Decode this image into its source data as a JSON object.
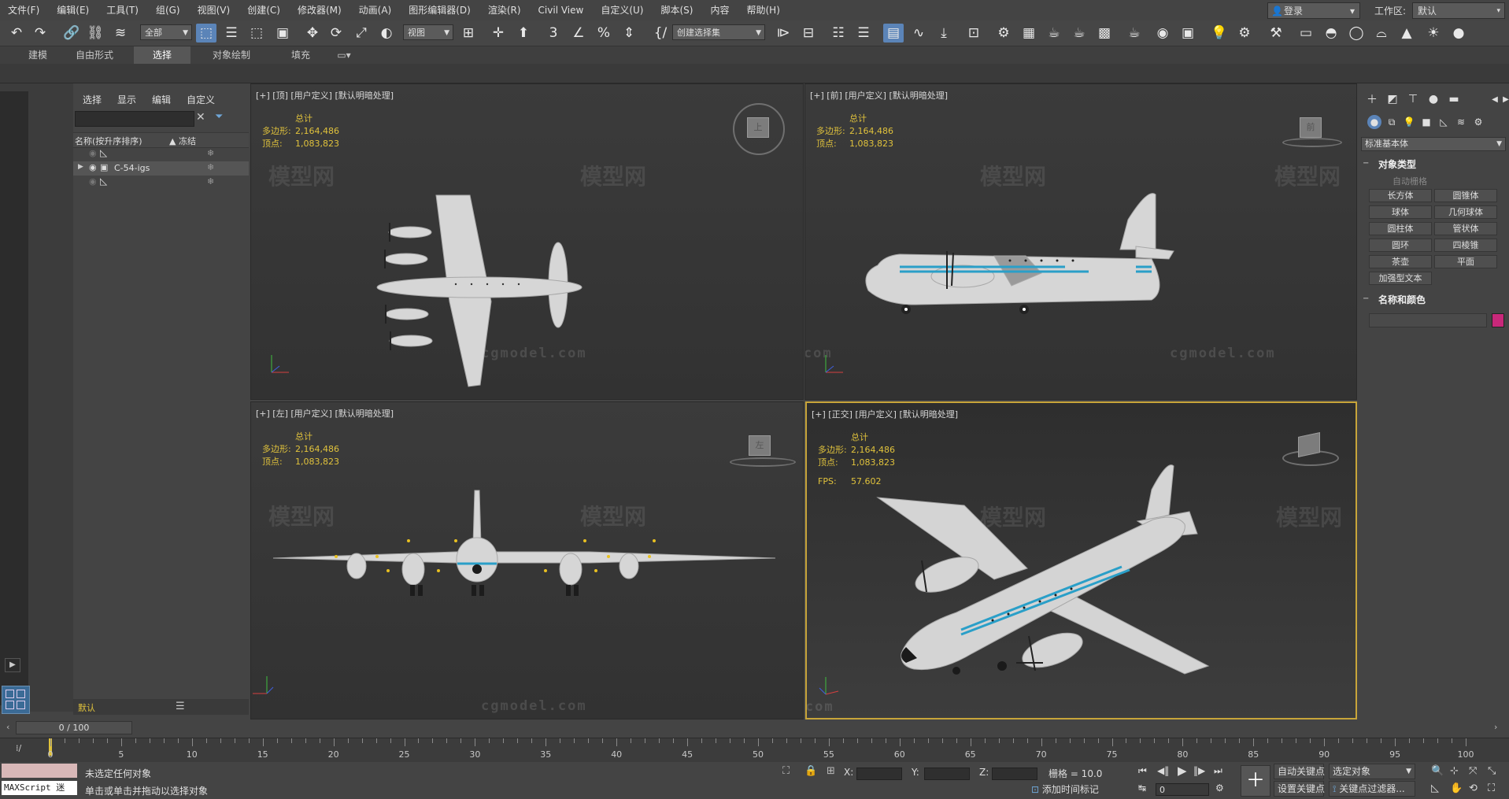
{
  "menu": [
    "文件(F)",
    "编辑(E)",
    "工具(T)",
    "组(G)",
    "视图(V)",
    "创建(C)",
    "修改器(M)",
    "动画(A)",
    "图形编辑器(D)",
    "渲染(R)",
    "Civil View",
    "自定义(U)",
    "脚本(S)",
    "内容",
    "帮助(H)"
  ],
  "account": {
    "login": "登录",
    "workspace_label": "工作区:",
    "workspace_value": "默认"
  },
  "toolbar": {
    "filter": "全部",
    "ref_coord": "视图",
    "selection_set": "创建选择集"
  },
  "ribbon": {
    "tabs": [
      "建模",
      "自由形式",
      "选择",
      "对象绘制",
      "填充"
    ],
    "active": "选择"
  },
  "explorer": {
    "menu": [
      "选择",
      "显示",
      "编辑",
      "自定义"
    ],
    "col_name": "名称(按升序排序)",
    "col_freeze": "▲ 冻结",
    "rows": [
      "",
      "C-54-igs",
      ""
    ],
    "layer": "默认"
  },
  "viewports": [
    {
      "label": "[+] [顶] [用户定义] [默认明暗处理]",
      "total": "总计",
      "poly_label": "多边形:",
      "poly": "2,164,486",
      "vert_label": "顶点:",
      "vert": "1,083,823"
    },
    {
      "label": "[+] [前] [用户定义] [默认明暗处理]",
      "total": "总计",
      "poly_label": "多边形:",
      "poly": "2,164,486",
      "vert_label": "顶点:",
      "vert": "1,083,823"
    },
    {
      "label": "[+] [左] [用户定义] [默认明暗处理]",
      "total": "总计",
      "poly_label": "多边形:",
      "poly": "2,164,486",
      "vert_label": "顶点:",
      "vert": "1,083,823"
    },
    {
      "label": "[+] [正交] [用户定义] [默认明暗处理]",
      "total": "总计",
      "poly_label": "多边形:",
      "poly": "2,164,486",
      "vert_label": "顶点:",
      "vert": "1,083,823",
      "fps_label": "FPS:",
      "fps": "57.602"
    }
  ],
  "viewcube": {
    "top": "上",
    "front": "前",
    "left": "左"
  },
  "watermark": {
    "logo": "模型网",
    "site": "cgmodel.com"
  },
  "command_panel": {
    "category": "标准基本体",
    "rollout_type": "对象类型",
    "autogrid": "自动栅格",
    "buttons": [
      "长方体",
      "圆锥体",
      "球体",
      "几何球体",
      "圆柱体",
      "管状体",
      "圆环",
      "四棱锥",
      "茶壶",
      "平面",
      "加强型文本"
    ],
    "rollout_name": "名称和颜色",
    "color": "#c8287a"
  },
  "time": {
    "frame": "0 / 100",
    "ticks": [
      0,
      5,
      10,
      15,
      20,
      25,
      30,
      35,
      40,
      45,
      50,
      55,
      60,
      65,
      70,
      75,
      80,
      85,
      90,
      95,
      100
    ]
  },
  "status": {
    "script_label": "MAXScript 迷",
    "line1": "未选定任何对象",
    "line2": "单击或单击并拖动以选择对象",
    "x": "X:",
    "y": "Y:",
    "z": "Z:",
    "grid": "栅格 = 10.0",
    "add_time_tag": "添加时间标记",
    "auto_key": "自动关键点",
    "set_key": "设置关键点",
    "selected_object": "选定对象",
    "key_filters": "关键点过滤器...",
    "frame_value": "0"
  }
}
